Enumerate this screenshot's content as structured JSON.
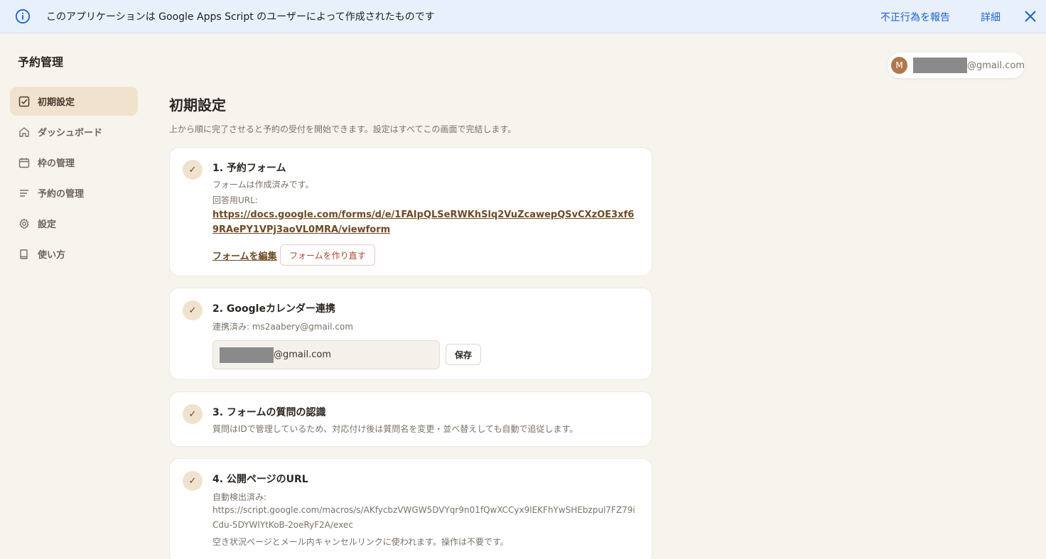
{
  "banner": {
    "message": "このアプリケーションは Google Apps Script のユーザーによって作成されたものです",
    "report_label": "不正行為を報告",
    "details_label": "詳細"
  },
  "app": {
    "title": "予約管理"
  },
  "nav": {
    "items": [
      {
        "label": "初期設定",
        "icon": "checkbox-icon",
        "active": true
      },
      {
        "label": "ダッシュボード",
        "icon": "home-icon",
        "active": false
      },
      {
        "label": "枠の管理",
        "icon": "calendar-icon",
        "active": false
      },
      {
        "label": "予約の管理",
        "icon": "list-icon",
        "active": false
      },
      {
        "label": "設定",
        "icon": "gear-icon",
        "active": false
      },
      {
        "label": "使い方",
        "icon": "book-icon",
        "active": false
      }
    ]
  },
  "user": {
    "initial": "M",
    "email_suffix": "@gmail.com"
  },
  "page": {
    "title": "初期設定",
    "subtitle": "上から順に完了させると予約の受付を開始できます。設定はすべてこの画面で完結します。"
  },
  "steps": {
    "form": {
      "check": "✓",
      "title": "1. 予約フォーム",
      "status": "フォームは作成済みです。",
      "url_label": "回答用URL:",
      "url": "https://docs.google.com/forms/d/e/1FAIpQLSeRWKhSlq2VuZcawepQSvCXzOE3xf69RAePY1VPj3aoVL0MRA/viewform",
      "edit_label": "フォームを編集",
      "recreate_label": "フォームを作り直す"
    },
    "calendar": {
      "check": "✓",
      "title": "2. Googleカレンダー連携",
      "status": "連携済み: ms2aabery@gmail.com",
      "input_suffix": "@gmail.com",
      "save_label": "保存"
    },
    "questions": {
      "check": "✓",
      "title": "3. フォームの質問の認識",
      "description": "質問はIDで管理しているため、対応付け後は質問名を変更・並べ替えしても自動で追従します。"
    },
    "public_url": {
      "check": "✓",
      "title": "4. 公開ページのURL",
      "status": "自動検出済み:",
      "url": "https://script.google.com/macros/s/AKfycbzVWGW5DVYqr9n01fQwXCCyx9lEKFhYwSHEbzpul7FZ79iCdu-5DYWIYtKoB-2oeRyF2A/exec",
      "note": "空き状況ページとメール内キャンセルリンクに使われます。操作は不要です。"
    }
  },
  "colors": {
    "accent": "#f1e2cd",
    "link": "#1a62c9",
    "danger": "#b24a32",
    "avatar": "#b0784b"
  }
}
